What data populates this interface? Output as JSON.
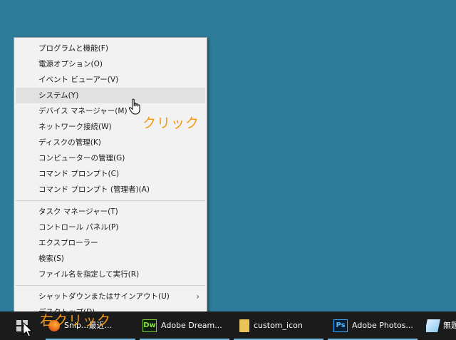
{
  "context_menu": {
    "group1": [
      {
        "label": "プログラムと機能(F)"
      },
      {
        "label": "電源オプション(O)"
      },
      {
        "label": "イベント ビューアー(V)"
      },
      {
        "label": "システム(Y)"
      },
      {
        "label": "デバイス マネージャー(M)"
      },
      {
        "label": "ネットワーク接続(W)"
      },
      {
        "label": "ディスクの管理(K)"
      },
      {
        "label": "コンピューターの管理(G)"
      },
      {
        "label": "コマンド プロンプト(C)"
      },
      {
        "label": "コマンド プロンプト (管理者)(A)"
      }
    ],
    "group2": [
      {
        "label": "タスク マネージャー(T)"
      },
      {
        "label": "コントロール パネル(P)"
      },
      {
        "label": "エクスプローラー"
      },
      {
        "label": "検索(S)"
      },
      {
        "label": "ファイル名を指定して実行(R)"
      }
    ],
    "group3": [
      {
        "label": "シャットダウンまたはサインアウト(U)",
        "submenu_arrow": "›"
      },
      {
        "label": "デスクトップ(D)"
      }
    ],
    "highlighted_item": "システム(Y)"
  },
  "annotations": {
    "click": "クリック",
    "right_click": "右クリック"
  },
  "taskbar": {
    "items": [
      {
        "label": "Snip...最近...",
        "icon": "firefox-icon"
      },
      {
        "label": "Adobe Dream...",
        "icon": "dreamweaver-icon",
        "icon_text": "Dw"
      },
      {
        "label": "custom_icon",
        "icon": "folder-icon"
      },
      {
        "label": "Adobe Photos...",
        "icon": "photoshop-icon",
        "icon_text": "Ps"
      },
      {
        "label": "無題",
        "icon": "notepad-icon"
      }
    ]
  },
  "colors": {
    "desktop": "#2f7b9a",
    "taskbar": "#1b1b1b",
    "menu_bg": "#f2f2f2",
    "highlight": "#e1e1e1",
    "annotation": "#f59a12"
  }
}
